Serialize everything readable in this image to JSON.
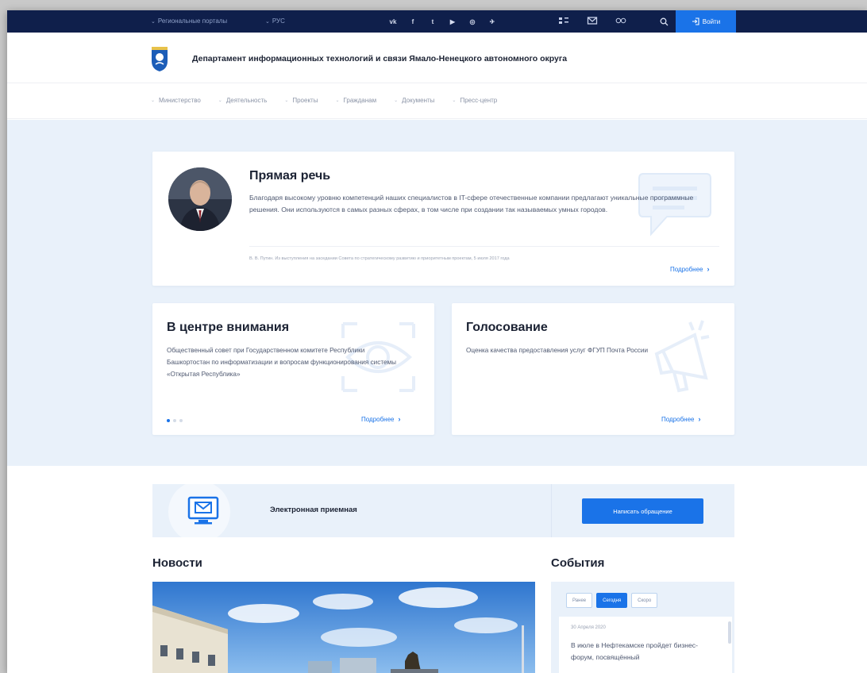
{
  "topbar": {
    "regional_portals": "Региональные порталы",
    "language": "РУС",
    "socials": [
      {
        "icon": "vk-icon",
        "glyph": "vk"
      },
      {
        "icon": "facebook-icon",
        "glyph": "f"
      },
      {
        "icon": "twitter-icon",
        "glyph": "t"
      },
      {
        "icon": "youtube-icon",
        "glyph": "▶"
      },
      {
        "icon": "instagram-icon",
        "glyph": "◎"
      },
      {
        "icon": "telegram-icon",
        "glyph": "✈"
      }
    ],
    "login_label": "Войти"
  },
  "header": {
    "title": "Департамент информационных технологий и связи Ямало-Ненецкого автономного округа"
  },
  "nav": {
    "items": [
      "Министерство",
      "Деятельность",
      "Проекты",
      "Гражданам",
      "Документы",
      "Пресс-центр"
    ]
  },
  "quote": {
    "title": "Прямая речь",
    "text": "Благодаря высокому уровню компетенций наших специалистов в IT-сфере отечественные компании предлагают уникальные программные решения. Они используются в самых разных сферах, в том числе при создании так называемых умных городов.",
    "source": "В. В. Путин. Из выступления на заседании Совета по стратегическому развитию и приоритетным проектам, 5 июля 2017 года",
    "more": "Подробнее"
  },
  "focus": {
    "title": "В центре внимания",
    "text": "Общественный совет при Государственном комитете Республики Башкортостан по информатизации и вопросам функционирования системы «Открытая Республика»",
    "more": "Подробнее"
  },
  "vote": {
    "title": "Голосование",
    "text": "Оценка качества предоставления услуг ФГУП Почта России",
    "more": "Подробнее"
  },
  "reception": {
    "title": "Электронная приемная",
    "button": "Написать обращение"
  },
  "news": {
    "title": "Новости"
  },
  "events": {
    "title": "События",
    "tabs": [
      "Ранее",
      "Сегодня",
      "Скоро"
    ],
    "active_tab": "Сегодня",
    "date": "30 Апреля 2020",
    "text": "В июле в Нефтекамске пройдет бизнес-форум, посвящённый"
  },
  "colors": {
    "topbar": "#0f1f4b",
    "accent": "#1a73e8",
    "hero_bg": "#e9f1fa"
  }
}
